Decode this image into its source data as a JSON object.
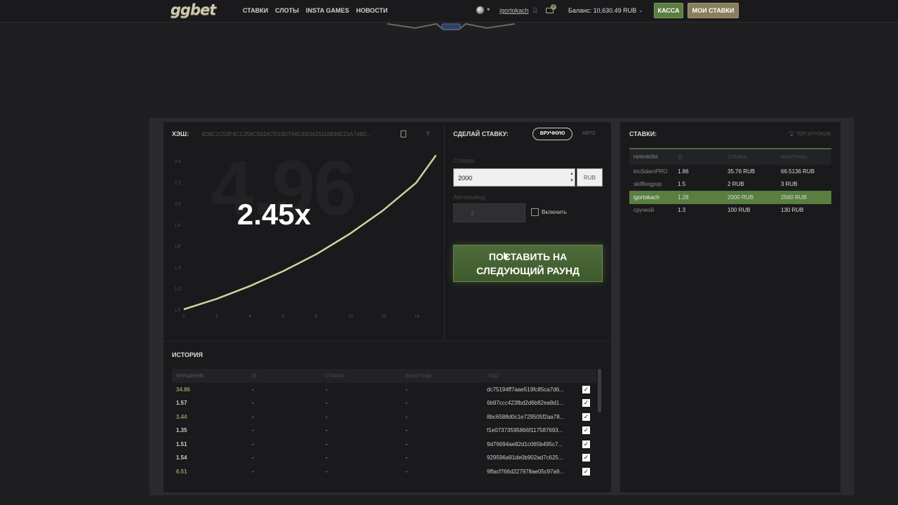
{
  "header": {
    "logo": "ggbet",
    "nav": [
      "СТАВКИ",
      "СЛОТЫ",
      "INSTA GAMES",
      "НОВОСТИ"
    ],
    "username": "igortokach",
    "mail_count": "0",
    "balance": "Баланс: 10,630.49 RUB",
    "kassa_label": "КАССА",
    "my_bets_label": "МОИ СТАВКИ"
  },
  "game": {
    "hash_label": "ХЭШ:",
    "hash_value": "4D8C1C52F4CC256C562A7D16D7A8CE83425116834E23A746D...",
    "help": "?",
    "background_text": "4.96",
    "multiplier": "2.45x"
  },
  "chart_data": {
    "type": "line",
    "x_ticks": [
      "0",
      "2",
      "4",
      "6",
      "8",
      "10",
      "12",
      "14"
    ],
    "y_ticks": [
      "1.0",
      "1.2",
      "1.4",
      "1.6",
      "1.8",
      "2.0",
      "2.2",
      "2.4"
    ],
    "xlim": [
      0,
      14
    ],
    "ylim": [
      1.0,
      2.4
    ],
    "series": [
      {
        "values_x": [
          0,
          2,
          4,
          6,
          8,
          10,
          12,
          14,
          15.2
        ],
        "values_y": [
          1.0,
          1.1,
          1.22,
          1.36,
          1.52,
          1.71,
          1.93,
          2.19,
          2.45
        ]
      }
    ],
    "color": "#d4d0a0"
  },
  "bet_panel": {
    "title": "СДЕЛАЙ СТАВКУ:",
    "mode_manual": "ВРУЧНУЮ",
    "mode_auto": "АВТО",
    "stake_label": "Ставка",
    "stake_value": "2000",
    "currency": "RUB",
    "autocashout_label": "Автовывод",
    "autocashout_value": "2",
    "enable_label": "Включить",
    "place_button_line1": "ПОСТАВИТЬ НА",
    "place_button_line2": "СЛЕДУЮЩИЙ РАУНД"
  },
  "history": {
    "title": "ИСТОРИЯ",
    "columns": [
      "КРУШЕНИЕ",
      "@",
      "СТАВКА",
      "ВЫИГРЫШ",
      "ХЭШ"
    ],
    "rows": [
      {
        "crash": "34.86",
        "at": "-",
        "stake": "-",
        "win": "-",
        "hash": "dc75194ff7aae519fc85ca7d6...",
        "green": true
      },
      {
        "crash": "1.57",
        "at": "-",
        "stake": "-",
        "win": "-",
        "hash": "6b97ccc423fbd2d6b82ea8d1...",
        "green": false
      },
      {
        "crash": "3.44",
        "at": "-",
        "stake": "-",
        "win": "-",
        "hash": "8bc6588d0c1e729505f2aa78...",
        "green": true
      },
      {
        "crash": "1.35",
        "at": "-",
        "stake": "-",
        "win": "-",
        "hash": "f1e07373595866f117587693...",
        "green": false
      },
      {
        "crash": "1.51",
        "at": "-",
        "stake": "-",
        "win": "-",
        "hash": "9d76694ae82d1c065b495c7...",
        "green": false
      },
      {
        "crash": "1.54",
        "at": "-",
        "stake": "-",
        "win": "-",
        "hash": "929596a91de0b902ad7c625...",
        "green": false
      },
      {
        "crash": "6.51",
        "at": "-",
        "stake": "-",
        "win": "-",
        "hash": "9ffacf766d227978ae05c97a9...",
        "green": true
      }
    ]
  },
  "bets": {
    "title": "СТАВКИ:",
    "top_players": "ТОП ИГРОКОВ",
    "columns": [
      "НИКНЕЙМ",
      "@",
      "СТАВКА",
      "ВЫИГРЫШ"
    ],
    "rows": [
      {
        "nick": "kloSdamPRO",
        "at": "1.86",
        "stake": "35.76 RUB",
        "win": "66.5136 RUB",
        "me": false
      },
      {
        "nick": "skiffkegpup",
        "at": "1.5",
        "stake": "2 RUB",
        "win": "3 RUB",
        "me": false
      },
      {
        "nick": "igortokach",
        "at": "1.28",
        "stake": "2000 RUB",
        "win": "2560 RUB",
        "me": true
      },
      {
        "nick": "сручкой",
        "at": "1.3",
        "stake": "100 RUB",
        "win": "130 RUB",
        "me": false
      }
    ]
  }
}
